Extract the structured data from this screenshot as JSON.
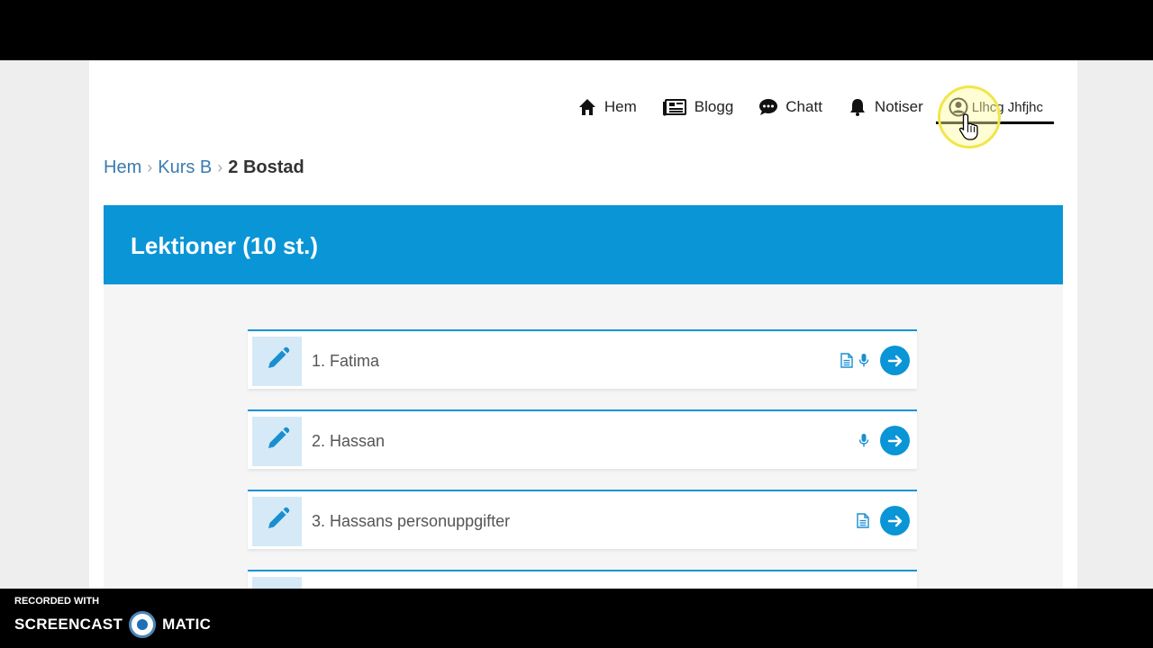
{
  "nav": {
    "items": [
      {
        "label": "Hem",
        "icon": "home-icon"
      },
      {
        "label": "Blogg",
        "icon": "newspaper-icon"
      },
      {
        "label": "Chatt",
        "icon": "chat-icon"
      },
      {
        "label": "Notiser",
        "icon": "bell-icon"
      }
    ],
    "user": {
      "label": "Llhcg Jhfjhc",
      "icon": "user-circle-icon"
    }
  },
  "breadcrumb": {
    "items": [
      "Hem",
      "Kurs B"
    ],
    "current": "2 Bostad"
  },
  "panel": {
    "title": "Lektioner (10 st.)"
  },
  "lessons": [
    {
      "title": "1. Fatima",
      "icons": [
        "document-icon",
        "microphone-icon"
      ]
    },
    {
      "title": "2. Hassan",
      "icons": [
        "microphone-icon"
      ]
    },
    {
      "title": "3. Hassans personuppgifter",
      "icons": [
        "document-icon"
      ]
    }
  ],
  "watermark": {
    "line1": "RECORDED WITH",
    "brand_left": "SCREENCAST",
    "brand_right": "MATIC"
  },
  "colors": {
    "accent": "#0a95d6",
    "link": "#3b7bb0",
    "edit_bg": "#d6e9f6"
  }
}
